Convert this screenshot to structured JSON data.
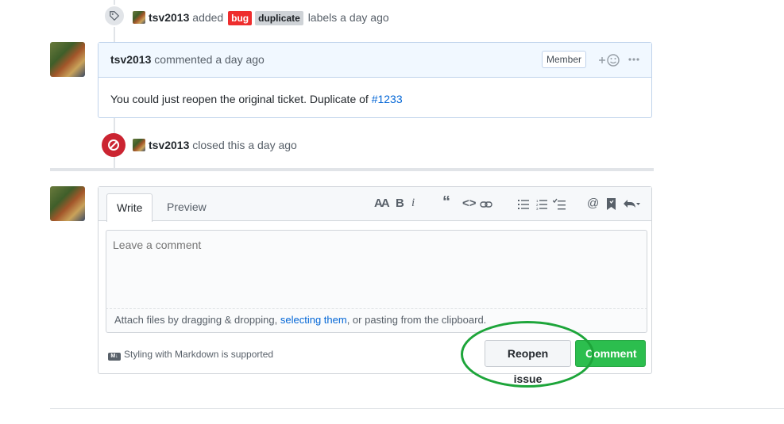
{
  "events": {
    "labeled": {
      "author": "tsv2013",
      "action": "added",
      "labels": [
        {
          "name": "bug",
          "bg": "#ee2e2e",
          "fg": "#ffffff"
        },
        {
          "name": "duplicate",
          "bg": "#cfd3d7",
          "fg": "#1b1f23"
        }
      ],
      "suffix": "labels a day ago",
      "icon": "tag-icon"
    },
    "closed": {
      "author": "tsv2013",
      "text": "closed this a day ago",
      "icon": "circle-slash-icon",
      "color": "#cb2431"
    }
  },
  "comment": {
    "author": "tsv2013",
    "meta": "commented a day ago",
    "badge": "Member",
    "body_text": "You could just reopen the original ticket. Duplicate of",
    "body_link": "#1233",
    "reaction_icon": "smiley-plus-icon",
    "more_icon": "kebab-horizontal-icon"
  },
  "editor": {
    "tabs": {
      "write": "Write",
      "preview": "Preview"
    },
    "toolbar_icons": [
      "text-size-icon",
      "bold-icon",
      "italic-icon",
      "quote-icon",
      "code-icon",
      "link-icon",
      "list-unordered-icon",
      "list-ordered-icon",
      "tasklist-icon",
      "mention-icon",
      "bookmark-icon",
      "reply-icon"
    ],
    "placeholder": "Leave a comment",
    "attach_prefix": "Attach files by dragging & dropping,",
    "attach_link": "selecting them",
    "attach_suffix": ", or pasting from the clipboard.",
    "markdown_note": "Styling with Markdown is supported",
    "reopen_label": "Reopen issue",
    "comment_label": "Comment"
  },
  "colors": {
    "accent_link": "#0366d6",
    "comment_green": "#2cbe4e",
    "annotation_green": "#1da53a"
  }
}
